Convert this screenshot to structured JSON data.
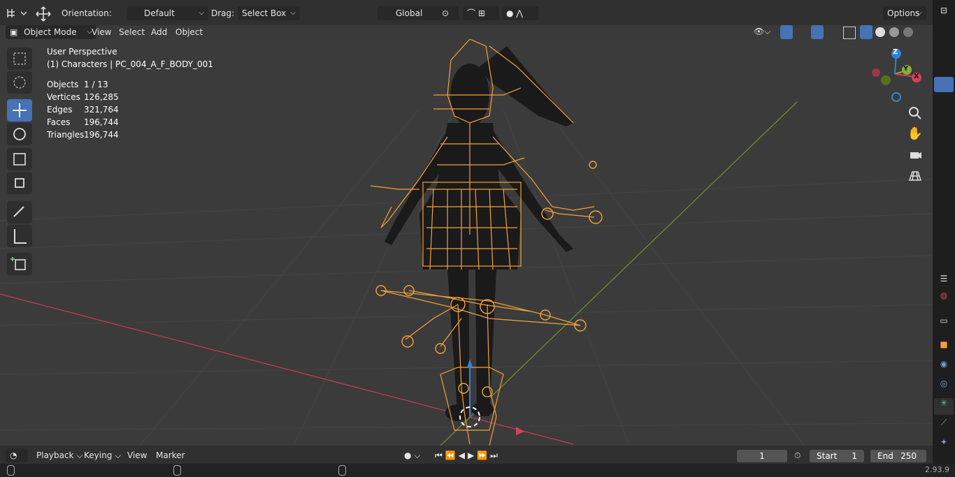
{
  "header": {
    "orientation_label": "Orientation:",
    "orientation_value": "Default",
    "drag_label": "Drag:",
    "drag_value": "Select Box",
    "transform_space": "Global",
    "options_label": "Options"
  },
  "subheader": {
    "mode": "Object Mode",
    "menus": [
      "View",
      "Select",
      "Add",
      "Object"
    ]
  },
  "overlay": {
    "perspective": "User Perspective",
    "collection": "(1) Characters | PC_004_A_F_BODY_001",
    "stats": [
      {
        "label": "Objects",
        "value": "1 / 13"
      },
      {
        "label": "Vertices",
        "value": "126,285"
      },
      {
        "label": "Edges",
        "value": "321,764"
      },
      {
        "label": "Faces",
        "value": "196,744"
      },
      {
        "label": "Triangles",
        "value": "196,744"
      }
    ]
  },
  "gizmo": {
    "z": "Z",
    "y": "Y",
    "x": "X"
  },
  "timeline": {
    "menus": [
      "Playback",
      "Keying",
      "View",
      "Marker"
    ],
    "current_frame": "1",
    "start_label": "Start",
    "start_value": "1",
    "end_label": "End",
    "end_value": "250"
  },
  "status": {
    "version": "2.93.9"
  },
  "colors": {
    "accent": "#4772b3",
    "armature": "#f5a03a",
    "x_axis": "#d1435b",
    "y_axis": "#8bab3b",
    "z_axis": "#2f83d8"
  },
  "icons": [
    "editor-type-icon",
    "move-icon",
    "pivot-icon",
    "snap-icon",
    "proportional-icon",
    "visibility-icon",
    "gizmo-icon",
    "overlay-icon",
    "xray-icon",
    "wireframe-shading-icon",
    "solid-shading-icon",
    "material-shading-icon",
    "rendered-shading-icon",
    "zoom-icon",
    "hand-icon",
    "camera-icon",
    "grid-icon"
  ]
}
